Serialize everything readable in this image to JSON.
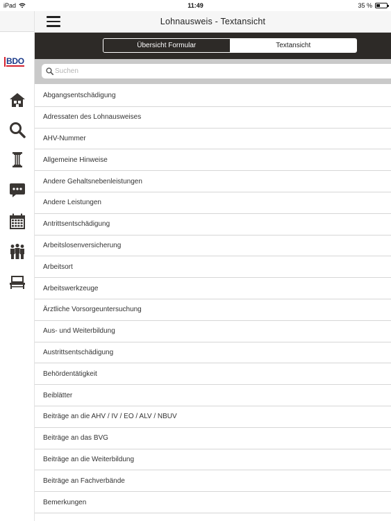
{
  "status": {
    "device": "iPad",
    "time": "11:49",
    "battery_text": "35 %",
    "battery_level": 0.35
  },
  "header": {
    "title": "Lohnausweis - Textansicht"
  },
  "logo": {
    "text": "BDO"
  },
  "segments": [
    {
      "label": "Übersicht Formular",
      "active": false
    },
    {
      "label": "Textansicht",
      "active": true
    }
  ],
  "search": {
    "placeholder": "Suchen",
    "value": ""
  },
  "sidebar": {
    "items": [
      {
        "icon": "house-icon"
      },
      {
        "icon": "search-icon"
      },
      {
        "icon": "column-icon"
      },
      {
        "icon": "chat-bubble-icon"
      },
      {
        "icon": "calendar-icon"
      },
      {
        "icon": "people-icon"
      },
      {
        "icon": "desk-icon"
      }
    ]
  },
  "list": {
    "items": [
      "Abgangsentschädigung",
      "Adressaten des Lohnausweises",
      "AHV-Nummer",
      "Allgemeine Hinweise",
      "Andere Gehaltsnebenleistungen",
      "Andere Leistungen",
      "Antrittsentschädigung",
      "Arbeitslosenversicherung",
      "Arbeitsort",
      "Arbeitswerkzeuge",
      "Ärztliche Vorsorgeuntersuchung",
      "Aus- und Weiterbildung",
      "Austrittsentschädigung",
      "Behördentätigkeit",
      "Beiblätter",
      "Beiträge an die AHV / IV / EO / ALV / NBUV",
      "Beiträge an das BVG",
      "Beiträge an die Weiterbildung",
      "Beiträge an Fachverbände",
      "Bemerkungen"
    ]
  },
  "colors": {
    "dark_bar": "#2d2a27",
    "icon": "#3a3633",
    "logo_red": "#d6212e",
    "logo_blue": "#1a3a8a"
  }
}
